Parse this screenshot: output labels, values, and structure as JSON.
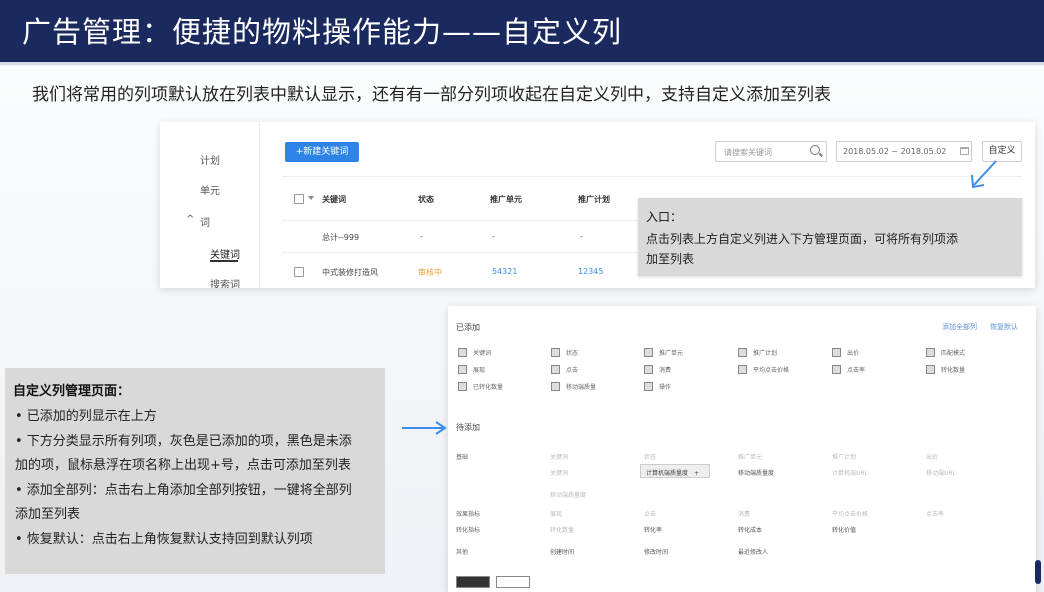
{
  "slide": {
    "title": "广告管理：便捷的物料操作能力——自定义列",
    "subtitle": "我们将常用的列项默认放在列表中默认显示，还有有一部分列项收起在自定义列中，支持自定义添加至列表"
  },
  "list_view": {
    "sidebar": [
      "计划",
      "单元",
      "词",
      "关键词",
      "搜索词"
    ],
    "new_button": "+新建关键词",
    "search_placeholder": "请搜索关键词",
    "date_range": "2018.05.02 ~ 2018.05.02",
    "custom_button": "自定义",
    "headers": [
      "关键词",
      "状态",
      "推广单元",
      "推广计划"
    ],
    "rows": [
      [
        "总计--999",
        "-",
        "-",
        "-"
      ],
      [
        "中式装修打造风",
        "审核中",
        "54321",
        "12345"
      ]
    ],
    "colors": {
      "primary": "#2d84e6",
      "status_pending": "#e6a23c",
      "link": "#3a8ee6"
    }
  },
  "entry_tip": {
    "title": "入口：",
    "lines": [
      "点击列表上方自定义列进入下方管理页面，可将所有列项添",
      "加至列表"
    ]
  },
  "custom_panel": {
    "added_title": "已添加",
    "add_all": "添加全部列",
    "restore": "恢复默认",
    "added_columns": [
      [
        "关键词",
        "状态",
        "推广单元",
        "推广计划",
        "出价",
        "匹配模式"
      ],
      [
        "展现",
        "点击",
        "消费",
        "平均点击价格",
        "点击率",
        "转化数量"
      ],
      [
        "已转化数量",
        "移动端质量",
        "操作"
      ]
    ],
    "pending_title": "待添加",
    "categories": [
      {
        "label": "基础",
        "options": [
          [
            {
              "t": "关键词",
              "g": true
            },
            {
              "t": "状态",
              "g": true
            },
            {
              "t": "推广单元",
              "g": true
            },
            {
              "t": "推广计划",
              "g": true
            },
            {
              "t": "出价",
              "g": true
            }
          ],
          [
            {
              "t": "关键词",
              "g": true
            },
            {
              "t": "计算机端质量度",
              "g": false
            },
            {
              "t": "移动端质量度",
              "g": false
            },
            {
              "t": "计算机端URL",
              "g": false
            },
            {
              "t": "移动端URL",
              "g": false
            }
          ],
          [
            {
              "t": "移动端质量度",
              "g": true
            }
          ]
        ]
      },
      {
        "label": "效果指标",
        "options": [
          [
            {
              "t": "展现",
              "g": true
            },
            {
              "t": "点击",
              "g": true
            },
            {
              "t": "消费",
              "g": true
            },
            {
              "t": "平均点击价格",
              "g": true
            },
            {
              "t": "点击率",
              "g": true
            }
          ]
        ]
      },
      {
        "label": "转化指标",
        "options": [
          [
            {
              "t": "转化数量",
              "g": true
            },
            {
              "t": "转化率",
              "g": false
            },
            {
              "t": "转化成本",
              "g": false
            },
            {
              "t": "转化价值",
              "g": false
            }
          ]
        ]
      },
      {
        "label": "其他",
        "options": [
          [
            {
              "t": "创建时间",
              "g": false
            },
            {
              "t": "修改时间",
              "g": false
            },
            {
              "t": "最近修改人",
              "g": false
            }
          ]
        ]
      }
    ],
    "hover_chip": "计算机端质量度",
    "hover_plus": "+"
  },
  "note": {
    "title": "自定义列管理页面：",
    "lines": [
      "• 已添加的列显示在上方",
      "• 下方分类显示所有列项，灰色是已添加的项，黑色是未添",
      "   加的项，鼠标悬浮在项名称上出现+号，点击可添加至列表",
      "• 添加全部列：点击右上角添加全部列按钮，一键将全部列",
      "   添加至列表",
      "• 恢复默认：点击右上角恢复默认支持回到默认列项"
    ]
  }
}
